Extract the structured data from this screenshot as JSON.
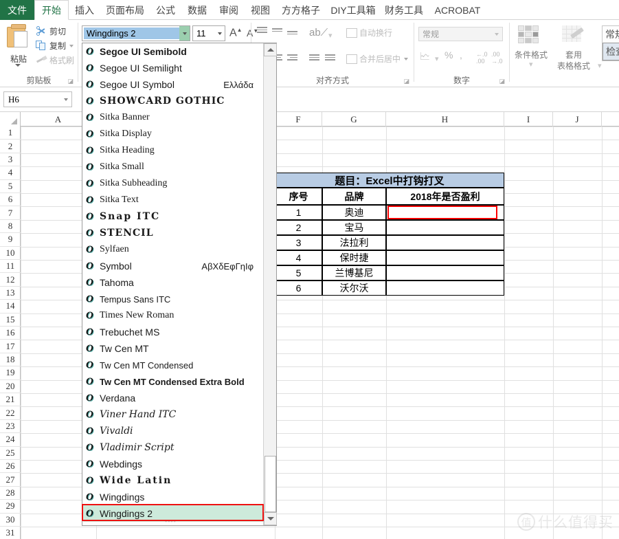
{
  "window": {
    "tabs": [
      {
        "label": "文件",
        "kind": "file"
      },
      {
        "label": "开始",
        "kind": "active"
      },
      {
        "label": "插入",
        "kind": "normal"
      },
      {
        "label": "页面布局",
        "kind": "normal"
      },
      {
        "label": "公式",
        "kind": "normal"
      },
      {
        "label": "数据",
        "kind": "normal"
      },
      {
        "label": "审阅",
        "kind": "normal"
      },
      {
        "label": "视图",
        "kind": "normal"
      },
      {
        "label": "方方格子",
        "kind": "normal"
      },
      {
        "label": "DIY工具箱",
        "kind": "normal"
      },
      {
        "label": "财务工具",
        "kind": "normal"
      },
      {
        "label": "ACROBAT",
        "kind": "normal"
      }
    ]
  },
  "ribbon": {
    "clipboard": {
      "group_label": "剪贴板",
      "paste_label": "粘贴",
      "cut_label": "剪切",
      "copy_label": "复制",
      "format_painter_label": "格式刷"
    },
    "font": {
      "font_name_value": "Wingdings 2",
      "font_size_value": "11",
      "grow_font": "A",
      "shrink_font": "A"
    },
    "alignment": {
      "group_label": "对齐方式",
      "wrap_text_label": "自动换行",
      "merge_center_label": "合并后居中"
    },
    "number": {
      "group_label": "数字",
      "format_value": "常规",
      "percent_label": "%",
      "comma_label": ",",
      "inc_decimal": ".00",
      "dec_decimal": ".00"
    },
    "styles": {
      "conditional_label": "条件格式",
      "table_style_label_line1": "套用",
      "table_style_label_line2": "表格格式",
      "cell_style_normal": "常规",
      "cell_style_check": "检查"
    }
  },
  "formula_bar": {
    "name_box_value": "H6"
  },
  "grid": {
    "columns": [
      "A",
      "F",
      "G",
      "H",
      "I",
      "J"
    ],
    "rows": [
      "1",
      "2",
      "3",
      "4",
      "5",
      "6",
      "7",
      "8",
      "9",
      "10",
      "11",
      "12",
      "13",
      "14",
      "15",
      "16",
      "17",
      "18",
      "19",
      "20",
      "21",
      "22",
      "23",
      "24",
      "25",
      "26",
      "27",
      "28",
      "29",
      "30",
      "31"
    ],
    "table": {
      "title": "题目：Excel中打钩打叉",
      "headers": [
        "序号",
        "品牌",
        "2018年是否盈利"
      ],
      "rows": [
        {
          "no": "1",
          "brand": "奥迪",
          "profit": ""
        },
        {
          "no": "2",
          "brand": "宝马",
          "profit": ""
        },
        {
          "no": "3",
          "brand": "法拉利",
          "profit": ""
        },
        {
          "no": "4",
          "brand": "保时捷",
          "profit": ""
        },
        {
          "no": "5",
          "brand": "兰博基尼",
          "profit": ""
        },
        {
          "no": "6",
          "brand": "沃尔沃",
          "profit": ""
        }
      ],
      "title_fill": "#b8cce4",
      "selection_color": "#ff0000"
    },
    "watermark": {
      "logo": "值",
      "text": "什么值得买"
    }
  },
  "font_dropdown": {
    "selected": "Wingdings 2",
    "items": [
      {
        "name": "Segoe UI Semibold",
        "sample": "",
        "face": "f-semibold"
      },
      {
        "name": "Segoe UI Semilight",
        "sample": "",
        "face": ""
      },
      {
        "name": "Segoe UI Symbol",
        "sample": "Ελλάδα",
        "face": ""
      },
      {
        "name": "SHOWCARD GOTHIC",
        "sample": "",
        "face": "f-stencil"
      },
      {
        "name": "Sitka Banner",
        "sample": "",
        "face": "f-serif"
      },
      {
        "name": "Sitka Display",
        "sample": "",
        "face": "f-serif"
      },
      {
        "name": "Sitka Heading",
        "sample": "",
        "face": "f-serif"
      },
      {
        "name": "Sitka Small",
        "sample": "",
        "face": "f-serif"
      },
      {
        "name": "Sitka Subheading",
        "sample": "",
        "face": "f-serif"
      },
      {
        "name": "Sitka Text",
        "sample": "",
        "face": "f-serif"
      },
      {
        "name": "Snap ITC",
        "sample": "",
        "face": "f-wide"
      },
      {
        "name": "STENCIL",
        "sample": "",
        "face": "f-stencil"
      },
      {
        "name": "Sylfaen",
        "sample": "",
        "face": "f-serif"
      },
      {
        "name": "Symbol",
        "sample": "ΑβΧδΕφΓηΙφ",
        "face": ""
      },
      {
        "name": "Tahoma",
        "sample": "",
        "face": ""
      },
      {
        "name": "Tempus Sans ITC",
        "sample": "",
        "face": "f-cond"
      },
      {
        "name": "Times New Roman",
        "sample": "",
        "face": "f-serif"
      },
      {
        "name": "Trebuchet MS",
        "sample": "",
        "face": ""
      },
      {
        "name": "Tw Cen MT",
        "sample": "",
        "face": ""
      },
      {
        "name": "Tw Cen MT Condensed",
        "sample": "",
        "face": "f-cond"
      },
      {
        "name": "Tw Cen MT Condensed Extra Bold",
        "sample": "",
        "face": "f-cond f-semibold"
      },
      {
        "name": "Verdana",
        "sample": "",
        "face": ""
      },
      {
        "name": "Viner Hand ITC",
        "sample": "",
        "face": "f-script"
      },
      {
        "name": "Vivaldi",
        "sample": "",
        "face": "f-script"
      },
      {
        "name": "Vladimir Script",
        "sample": "",
        "face": "f-script"
      },
      {
        "name": "Webdings",
        "sample": "",
        "face": ""
      },
      {
        "name": "Wide Latin",
        "sample": "",
        "face": "f-wide"
      },
      {
        "name": "Wingdings",
        "sample": "",
        "face": ""
      },
      {
        "name": "Wingdings 2",
        "sample": "",
        "face": ""
      }
    ],
    "otf_glyph": "O"
  }
}
